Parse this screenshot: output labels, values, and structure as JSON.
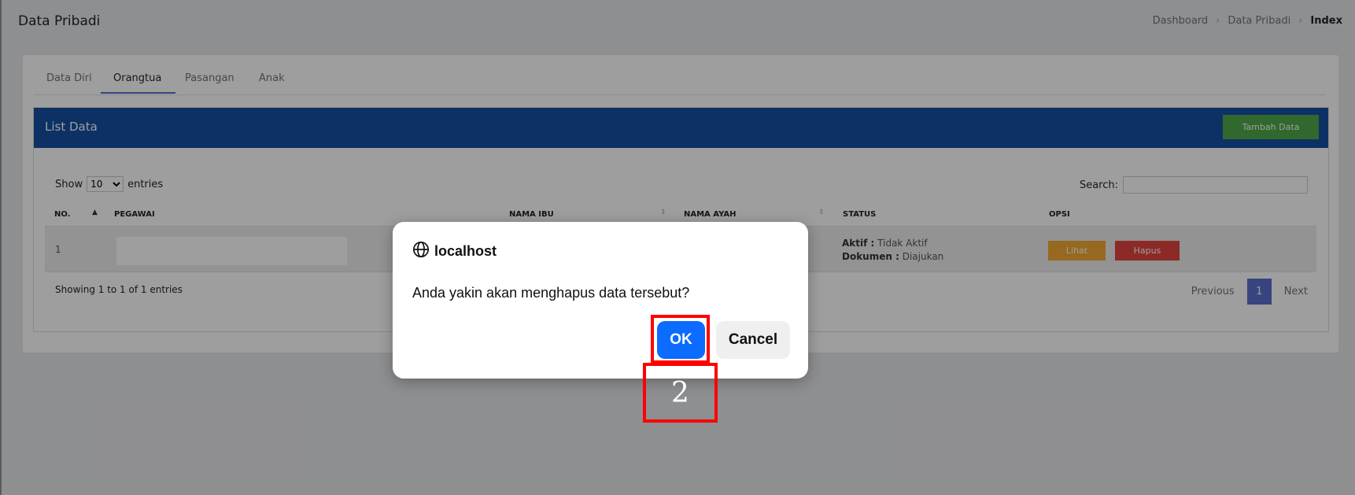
{
  "header": {
    "title": "Data Pribadi",
    "breadcrumb": [
      "Dashboard",
      "Data Pribadi",
      "Index"
    ]
  },
  "tabs": [
    "Data Diri",
    "Orangtua",
    "Pasangan",
    "Anak"
  ],
  "active_tab": "Orangtua",
  "panel": {
    "title": "List Data",
    "add_button": "Tambah Data"
  },
  "table_controls": {
    "show_label": "Show",
    "entries_value": "10",
    "entries_label": "entries",
    "search_label": "Search:"
  },
  "table": {
    "columns": [
      "NO.",
      "PEGAWAI",
      "NAMA IBU",
      "NAMA AYAH",
      "STATUS",
      "OPSI"
    ],
    "rows": [
      {
        "no": "1",
        "pegawai": "",
        "status_aktif_label": "Aktif :",
        "status_aktif_value": "Tidak Aktif",
        "status_dokumen_label": "Dokumen :",
        "status_dokumen_value": "Diajukan",
        "actions": [
          "Lihat",
          "Hapus"
        ]
      }
    ]
  },
  "footer": {
    "info": "Showing 1 to 1 of 1 entries",
    "previous": "Previous",
    "page": "1",
    "next": "Next"
  },
  "dialog": {
    "origin": "localhost",
    "message": "Anda yakin akan menghapus data tersebut?",
    "ok": "OK",
    "cancel": "Cancel"
  },
  "annotation": {
    "label": "2",
    "color": "#ff0000"
  },
  "colors": {
    "primary_header": "#164fa3",
    "add_button": "#4ea94a",
    "view_button": "#f2a935",
    "delete_button": "#e2453f",
    "ok_button": "#0b6cff",
    "tab_accent": "#5b6fcf"
  },
  "icons": {
    "dialog_origin": "globe-icon"
  }
}
